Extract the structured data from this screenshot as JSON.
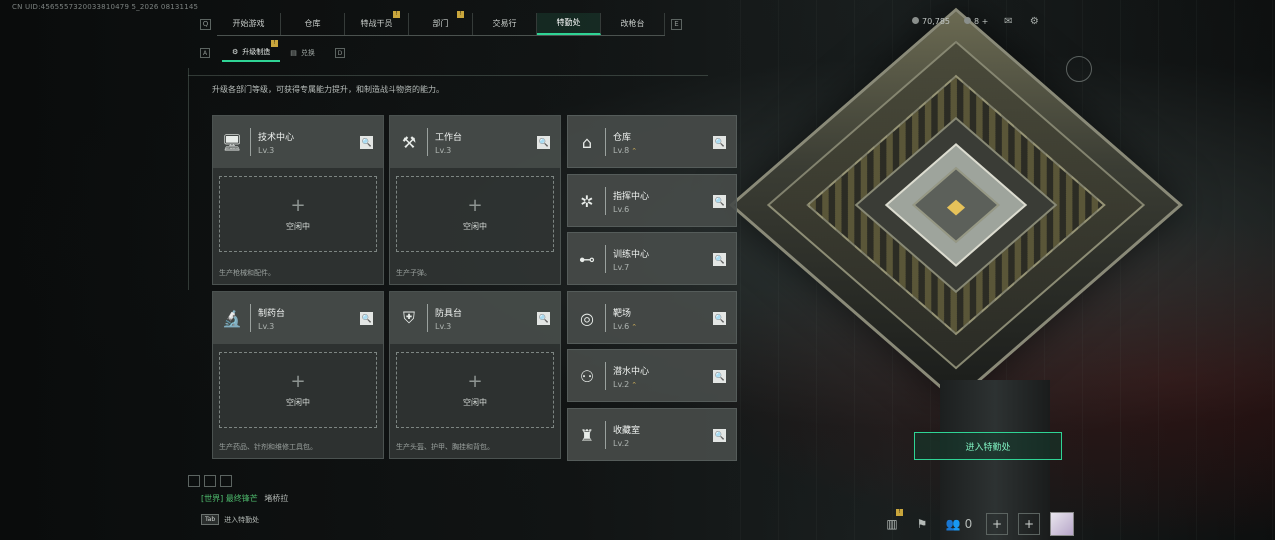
{
  "uid": "CN UID:4565557320033810479 5_2026 08131145",
  "nav": {
    "tabs": [
      {
        "label": "开始游戏",
        "badge": ""
      },
      {
        "label": "仓库",
        "badge": ""
      },
      {
        "label": "特战干员",
        "badge": "!"
      },
      {
        "label": "部门",
        "badge": "!"
      },
      {
        "label": "交易行",
        "badge": ""
      },
      {
        "label": "特勤处",
        "badge": "",
        "active": true
      },
      {
        "label": "改枪台",
        "badge": ""
      }
    ],
    "left_key": "Q",
    "right_key": "E"
  },
  "stats": {
    "currency": "70,785",
    "tickets": "8",
    "plus": "+"
  },
  "subnav": {
    "left_key": "A",
    "tabs": [
      {
        "label": "升级制造",
        "badge": "!"
      },
      {
        "label": "兑换"
      }
    ],
    "right_key": "D"
  },
  "description": "升级各部门等级，可获得专属能力提升，和制造战斗物资的能力。",
  "production": [
    {
      "name": "技术中心",
      "level": "Lv.3",
      "icon": "monitor-icon",
      "idle": "空闲中",
      "footer": "生产枪械和配件。"
    },
    {
      "name": "工作台",
      "level": "Lv.3",
      "icon": "tools-icon",
      "idle": "空闲中",
      "footer": "生产子弹。"
    },
    {
      "name": "制药台",
      "level": "Lv.3",
      "icon": "microscope-icon",
      "idle": "空闲中",
      "footer": "生产药品、针剂和维修工具包。"
    },
    {
      "name": "防具台",
      "level": "Lv.3",
      "icon": "armor-icon",
      "idle": "空闲中",
      "footer": "生产头盔、护甲、胸挂和背包。"
    }
  ],
  "facilities": [
    {
      "name": "仓库",
      "level": "Lv.8",
      "upgradable": true,
      "icon": "warehouse-icon"
    },
    {
      "name": "指挥中心",
      "level": "Lv.6",
      "upgradable": false,
      "icon": "chip-icon"
    },
    {
      "name": "训练中心",
      "level": "Lv.7",
      "upgradable": false,
      "icon": "dumbbell-icon"
    },
    {
      "name": "靶场",
      "level": "Lv.6",
      "upgradable": true,
      "icon": "target-icon"
    },
    {
      "name": "潜水中心",
      "level": "Lv.2",
      "upgradable": true,
      "icon": "goggles-icon"
    },
    {
      "name": "收藏室",
      "level": "Lv.2",
      "upgradable": false,
      "icon": "trophy-icon"
    }
  ],
  "enter_button": "进入特勤处",
  "chat": {
    "channel": "[世界]",
    "sender": "最终锋芒",
    "message": "堵桥拉"
  },
  "tab_hint": {
    "key": "Tab",
    "label": "进入特勤处"
  },
  "social": {
    "friends_count": "0",
    "badge": "!"
  },
  "colors": {
    "accent": "#2fd495",
    "upgrade_star": "#d4b45a",
    "badge": "#c9a63c"
  }
}
